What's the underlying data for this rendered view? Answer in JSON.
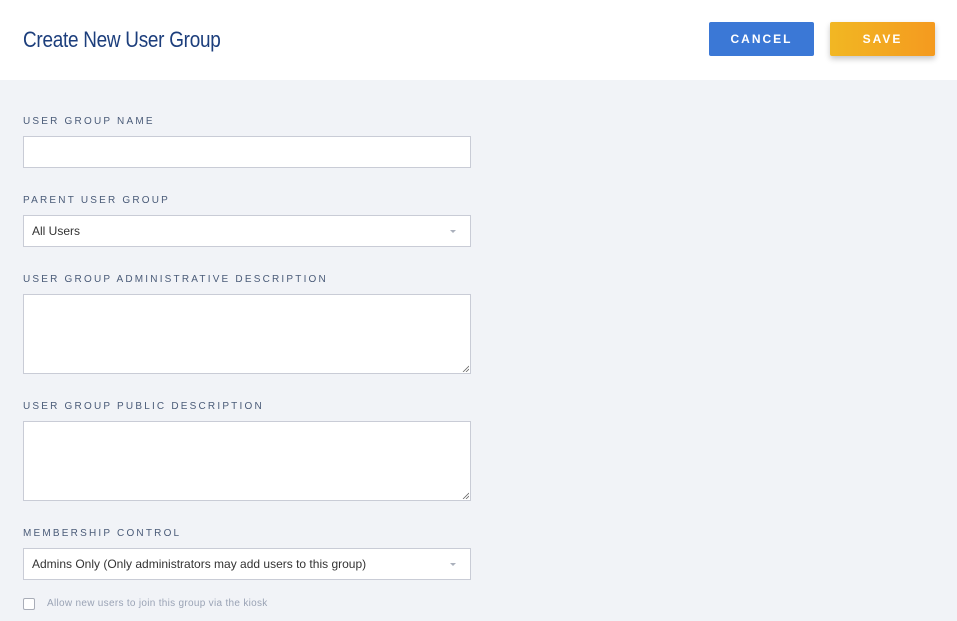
{
  "header": {
    "title": "Create New User Group",
    "cancel_label": "CANCEL",
    "save_label": "SAVE"
  },
  "form": {
    "name": {
      "label": "USER GROUP NAME",
      "value": ""
    },
    "parent": {
      "label": "PARENT USER GROUP",
      "selected": "All Users"
    },
    "admin_description": {
      "label": "USER GROUP ADMINISTRATIVE DESCRIPTION",
      "value": ""
    },
    "public_description": {
      "label": "USER GROUP PUBLIC DESCRIPTION",
      "value": ""
    },
    "membership": {
      "label": "MEMBERSHIP CONTROL",
      "selected": "Admins Only (Only administrators may add users to this group)"
    },
    "kiosk": {
      "label": "Allow new users to join this group via the kiosk",
      "checked": false
    }
  },
  "colors": {
    "title": "#1c3e7c",
    "cancel_button": "#3b78d6",
    "save_button_start": "#f2b723",
    "save_button_end": "#f49a1f",
    "background": "#f1f3f7"
  },
  "icons": {
    "select_caret": "chevron-down-icon",
    "resize_handle": "resize-grip-icon"
  }
}
